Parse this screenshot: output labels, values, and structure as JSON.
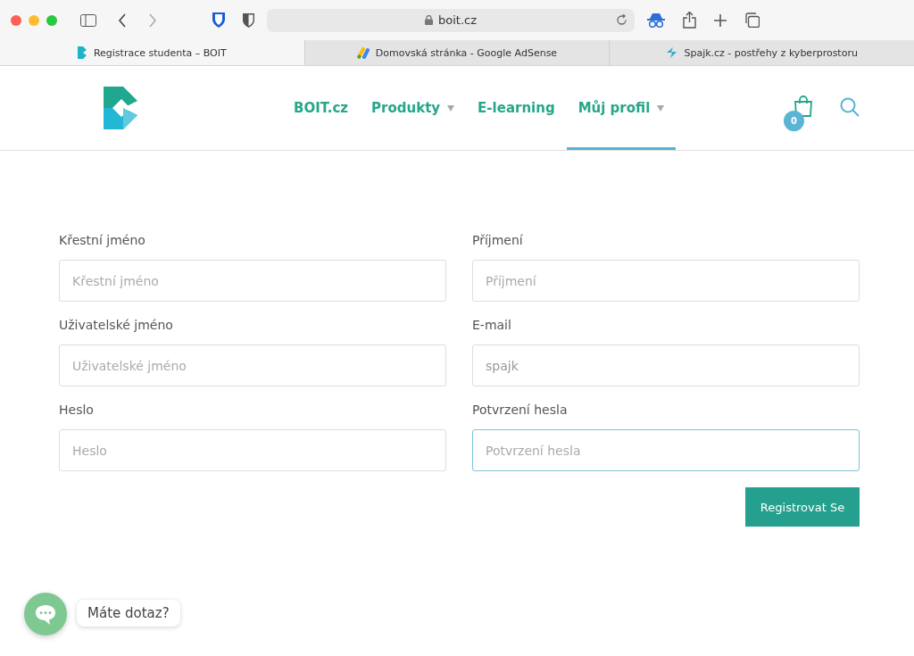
{
  "browser": {
    "address": "boit.cz",
    "tabs": [
      {
        "title": "Registrace studenta – BOIT",
        "selected": true,
        "kind": "boit"
      },
      {
        "title": "Domovská stránka - Google AdSense",
        "selected": false,
        "kind": "adsense"
      },
      {
        "title": "Spajk.cz - postřehy z kyberprostoru",
        "selected": false,
        "kind": "spajk"
      }
    ]
  },
  "nav": {
    "items": [
      {
        "label": "BOIT.cz",
        "dropdown": false,
        "selected": false
      },
      {
        "label": "Produkty",
        "dropdown": true,
        "selected": false
      },
      {
        "label": "E-learning",
        "dropdown": false,
        "selected": false
      },
      {
        "label": "Můj profil",
        "dropdown": true,
        "selected": true
      }
    ],
    "cart_count": "0"
  },
  "form": {
    "fields": [
      {
        "label": "Křestní jméno",
        "placeholder": "Křestní jméno",
        "focused": false
      },
      {
        "label": "Příjmení",
        "placeholder": "Příjmení",
        "focused": false
      },
      {
        "label": "Uživatelské jméno",
        "placeholder": "Uživatelské jméno",
        "focused": false
      },
      {
        "label": "E-mail",
        "value": "spajk",
        "focused": false
      },
      {
        "label": "Heslo",
        "placeholder": "Heslo",
        "focused": false
      },
      {
        "label": "Potvrzení hesla",
        "placeholder": "Potvrzení hesla",
        "focused": true
      }
    ],
    "submit": "Registrovat Se"
  },
  "chat": {
    "label": "Máte dotaz?"
  }
}
